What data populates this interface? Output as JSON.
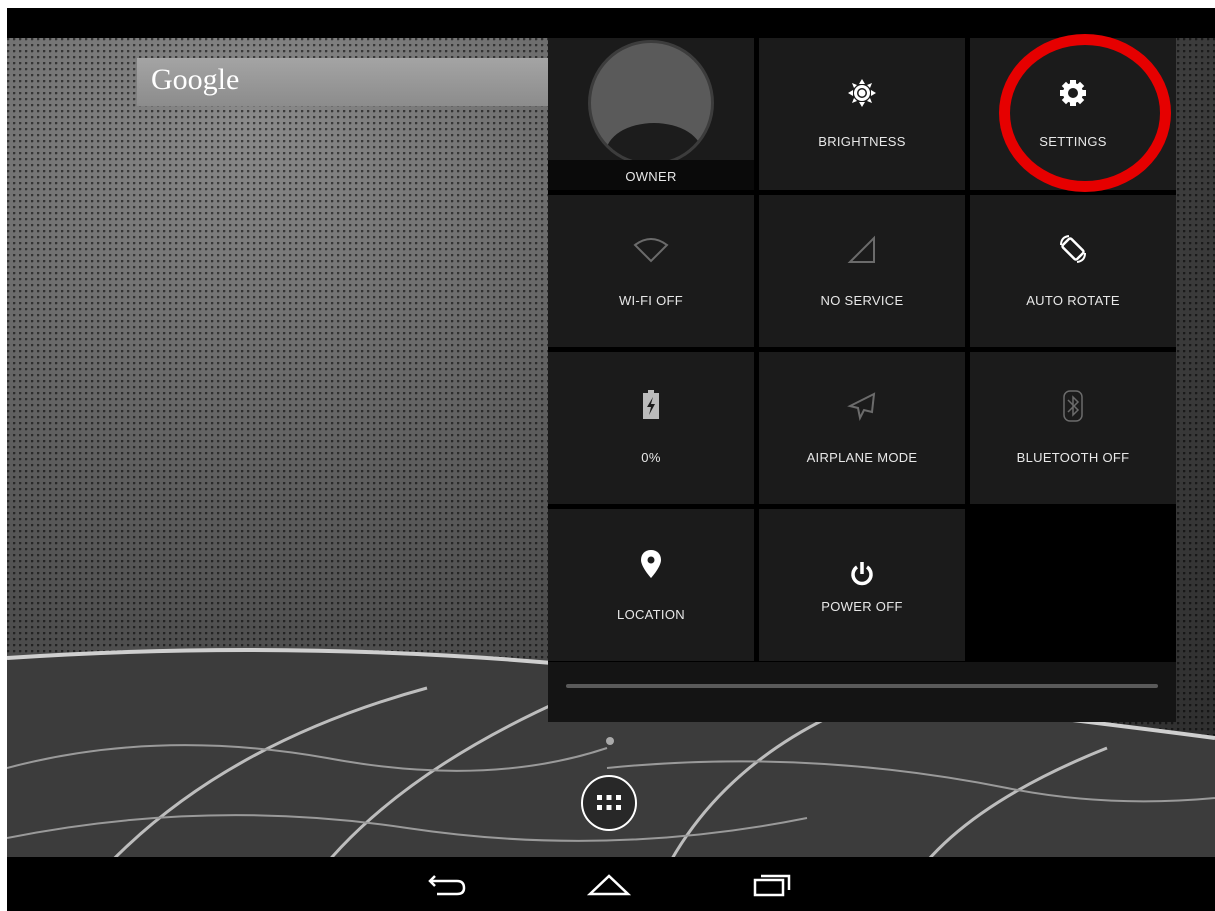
{
  "search": {
    "label": "Google"
  },
  "quick_settings": {
    "tiles": [
      {
        "label": "OWNER",
        "icon": "owner-avatar"
      },
      {
        "label": "BRIGHTNESS",
        "icon": "brightness-icon"
      },
      {
        "label": "SETTINGS",
        "icon": "gear-icon"
      },
      {
        "label": "WI-FI OFF",
        "icon": "wifi-off-icon"
      },
      {
        "label": "NO SERVICE",
        "icon": "signal-icon"
      },
      {
        "label": "AUTO ROTATE",
        "icon": "rotate-icon"
      },
      {
        "label": "0%",
        "icon": "battery-charging-icon"
      },
      {
        "label": "AIRPLANE MODE",
        "icon": "airplane-icon"
      },
      {
        "label": "BLUETOOTH OFF",
        "icon": "bluetooth-icon"
      },
      {
        "label": "LOCATION",
        "icon": "location-pin-icon"
      },
      {
        "label": "POWER OFF",
        "icon": "power-icon"
      }
    ]
  },
  "nav": {
    "back": "back-icon",
    "home": "home-icon",
    "recents": "recents-icon"
  },
  "colors": {
    "highlight": "#e60000",
    "tile_bg": "#1b1b1b",
    "panel_bg": "#000000"
  }
}
